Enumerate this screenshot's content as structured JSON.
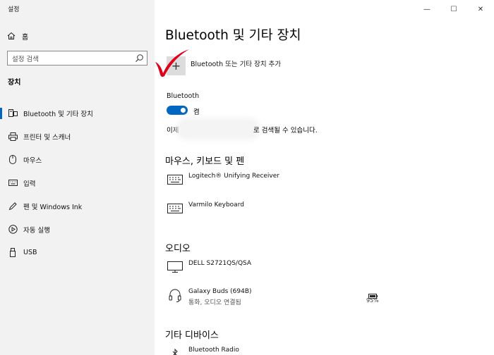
{
  "app": {
    "title": "설정"
  },
  "sidebar": {
    "home_label": "홈",
    "search_placeholder": "설정 검색",
    "section_label": "장치",
    "items": [
      {
        "label": "Bluetooth 및 기타 장치",
        "icon": "bluetooth-devices-icon",
        "active": true
      },
      {
        "label": "프린터 및 스캐너",
        "icon": "printer-icon",
        "active": false
      },
      {
        "label": "마우스",
        "icon": "mouse-icon",
        "active": false
      },
      {
        "label": "입력",
        "icon": "keyboard-icon",
        "active": false
      },
      {
        "label": "펜 및 Windows Ink",
        "icon": "pen-icon",
        "active": false
      },
      {
        "label": "자동 실행",
        "icon": "autoplay-icon",
        "active": false
      },
      {
        "label": "USB",
        "icon": "usb-icon",
        "active": false
      }
    ]
  },
  "window_controls": {
    "minimize": "—",
    "maximize": "☐",
    "close": "✕"
  },
  "main": {
    "title": "Bluetooth 및 기타 장치",
    "add_device_label": "Bluetooth 또는 기타 장치 추가",
    "bluetooth_label": "Bluetooth",
    "toggle_state": "켬",
    "discover_pre": "이제",
    "discover_post": "로 검색될 수 있습니다.",
    "sections": {
      "mouse_keyboard_pen": {
        "heading": "마우스, 키보드 및 펜",
        "devices": [
          {
            "name": "Logitech® Unifying Receiver",
            "icon": "keyboard-icon"
          },
          {
            "name": "Varmilo Keyboard",
            "icon": "keyboard-icon"
          }
        ]
      },
      "audio": {
        "heading": "오디오",
        "devices": [
          {
            "name": "DELL S2721QS/QSA",
            "icon": "monitor-icon"
          },
          {
            "name": "Galaxy Buds (694B)",
            "status": "통화, 오디오 연결됨",
            "battery": "95%",
            "icon": "headset-icon"
          }
        ]
      },
      "other": {
        "heading": "기타 디바이스",
        "devices": [
          {
            "name": "Bluetooth Radio",
            "icon": "bluetooth-icon"
          }
        ]
      }
    }
  },
  "colors": {
    "accent": "#0067c0",
    "sidebar_bg": "#f2f2f2",
    "checkmark": "#e0001b"
  }
}
